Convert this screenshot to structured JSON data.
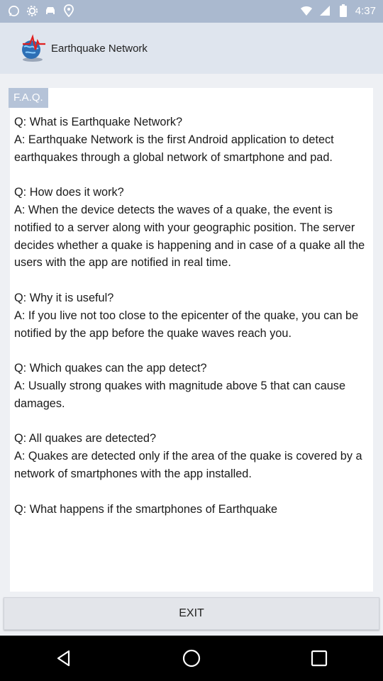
{
  "status_bar": {
    "time": "4:37",
    "left_icons": [
      "whatsapp-icon",
      "settings-gear-icon",
      "car-icon",
      "location-pin-icon"
    ],
    "right_icons": [
      "wifi-icon",
      "signal-icon",
      "battery-icon"
    ]
  },
  "app_bar": {
    "title": "Earthquake Network",
    "logo": "earthquake-globe-icon"
  },
  "faq": {
    "header": "F.A.Q.",
    "items": [
      {
        "q": "Q: What is Earthquake Network?",
        "a": "A: Earthquake Network is the first Android application to detect earthquakes through a global network of smartphone and pad."
      },
      {
        "q": "Q: How does it work?",
        "a": "A: When the device detects the waves of a quake, the event is notified to a server along with your geographic position. The server decides whether a quake is happening and in case of a quake all the users with the app are notified in real time."
      },
      {
        "q": "Q: Why it is useful?",
        "a": "A: If you live not too close to the epicenter of the quake, you can be notified by the app before the quake waves reach you."
      },
      {
        "q": "Q: Which quakes can the app detect?",
        "a": "A: Usually strong quakes with magnitude above 5 that can cause damages."
      },
      {
        "q": "Q: All quakes are detected?",
        "a": "A: Quakes are detected only if the area of the quake is covered by a network of smartphones with the app installed."
      },
      {
        "q": "Q: What happens if the smartphones of Earthquake",
        "a": ""
      }
    ]
  },
  "exit_label": "EXIT",
  "nav": {
    "back": "back-icon",
    "home": "home-icon",
    "recents": "recents-icon"
  }
}
